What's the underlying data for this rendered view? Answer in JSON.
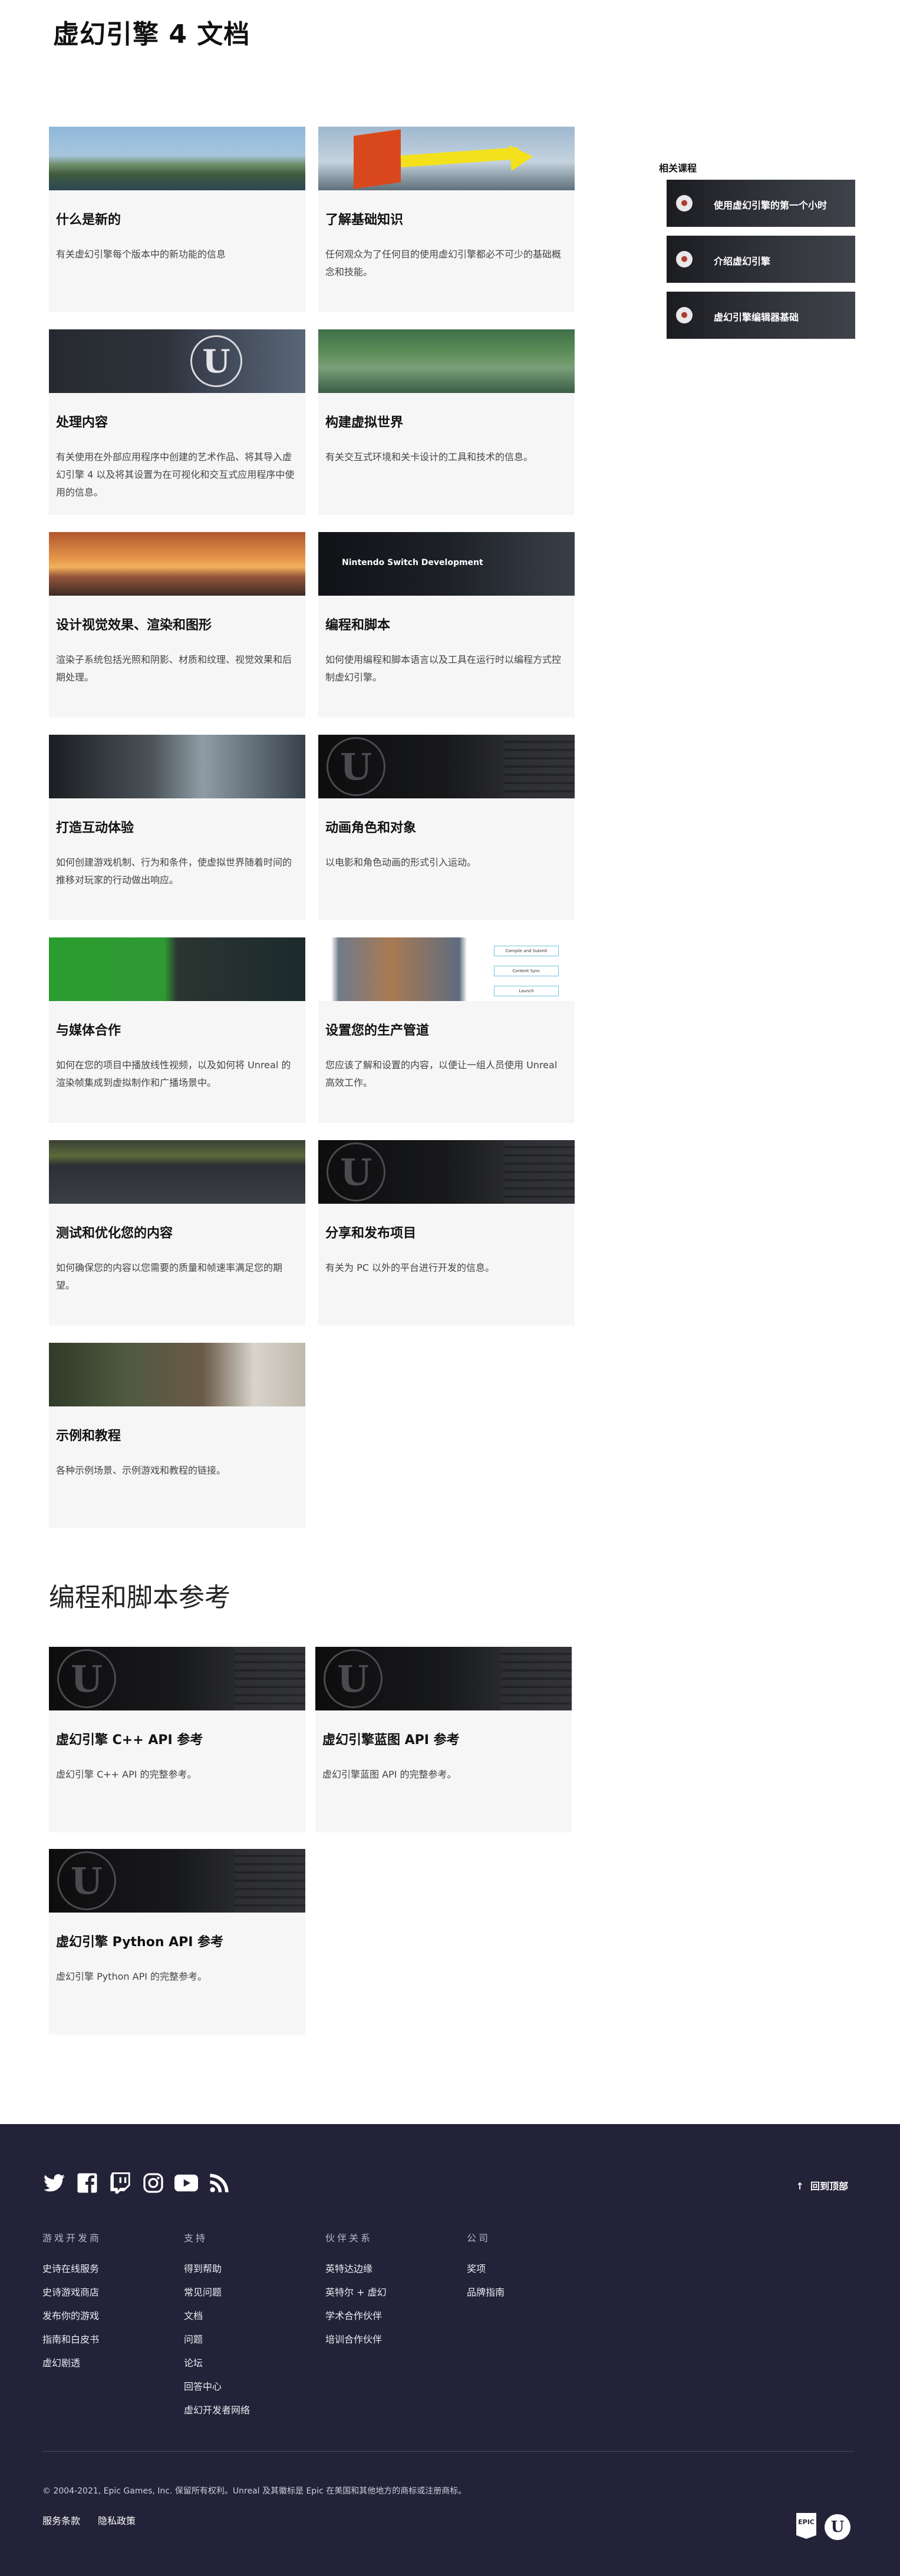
{
  "page": {
    "title": "虚幻引擎 4 文档"
  },
  "topics": [
    {
      "title": "什么是新的",
      "desc": "有关虚幻引擎每个版本中的新功能的信息",
      "thumb": "island-scene"
    },
    {
      "title": "了解基础知识",
      "desc": "任何观众为了任何目的使用虚幻引擎都必不可少的基础概念和技能。",
      "thumb": "arrow-scene"
    },
    {
      "title": "处理内容",
      "desc": "有关使用在外部应用程序中创建的艺术作品、将其导入虚幻引擎 4 以及将其设置为在可视化和交互式应用程序中使用的信息。",
      "thumb": "content-editor"
    },
    {
      "title": "构建虚拟世界",
      "desc": "有关交互式环境和关卡设计的工具和技术的信息。",
      "thumb": "village-scene"
    },
    {
      "title": "设计视觉效果、渲染和图形",
      "desc": "渲染子系统包括光照和阴影、材质和纹理、视觉效果和后期处理。",
      "thumb": "sunset-scene"
    },
    {
      "title": "编程和脚本",
      "desc": "如何使用编程和脚本语言以及工具在运行时以编程方式控制虚幻引擎。",
      "thumb": "switch-dev",
      "overlay": "Nintendo Switch Development"
    },
    {
      "title": "打造互动体验",
      "desc": "如何创建游戏机制、行为和条件，使虚拟世界随着时间的推移对玩家的行动做出响应。",
      "thumb": "speed-scene"
    },
    {
      "title": "动画角色和对象",
      "desc": "以电影和角色动画的形式引入运动。",
      "thumb": "ue-logo"
    },
    {
      "title": "与媒体合作",
      "desc": "如何在您的项目中播放线性视频，以及如何将 Unreal 的渲染帧集成到虚拟制作和广播场景中。",
      "thumb": "greenscreen"
    },
    {
      "title": "设置您的生产管道",
      "desc": "您应该了解和设置的内容，以便让一组人员使用 Unreal 高效工作。",
      "thumb": "pipeline",
      "boxes": [
        "Compile and Submit",
        "Content Sync",
        "Launch"
      ]
    },
    {
      "title": "测试和优化您的内容",
      "desc": "如何确保您的内容以您需要的质量和帧速率满足您的期望。",
      "thumb": "profiler"
    },
    {
      "title": "分享和发布项目",
      "desc": "有关为 PC 以外的平台进行开发的信息。",
      "thumb": "ue-logo"
    },
    {
      "title": "示例和教程",
      "desc": "各种示例场景、示例游戏和教程的链接。",
      "thumb": "samples"
    }
  ],
  "reference": {
    "heading": "编程和脚本参考",
    "items": [
      {
        "title": "虚幻引擎 C++ API 参考",
        "desc": "虚幻引擎 C++ API 的完整参考。"
      },
      {
        "title": "虚幻引擎蓝图 API 参考",
        "desc": "虚幻引擎蓝图 API 的完整参考。"
      },
      {
        "title": "虚幻引擎 Python API 参考",
        "desc": "虚幻引擎 Python API 的完整参考。"
      }
    ]
  },
  "related": {
    "heading": "相关课程",
    "items": [
      {
        "label": "使用虚幻引擎的第一个小时"
      },
      {
        "label": "介绍虚幻引擎"
      },
      {
        "label": "虚幻引擎编辑器基础"
      }
    ]
  },
  "footer": {
    "social": [
      "twitter-icon",
      "facebook-icon",
      "twitch-icon",
      "instagram-icon",
      "youtube-icon",
      "rss-icon"
    ],
    "back_to_top": "回到顶部",
    "columns": [
      {
        "heading": "游戏开发商",
        "links": [
          "史诗在线服务",
          "史诗游戏商店",
          "发布你的游戏",
          "指南和白皮书",
          "虚幻剧透"
        ]
      },
      {
        "heading": "支持",
        "links": [
          "得到帮助",
          "常见问题",
          "文档",
          "问题",
          "论坛",
          "回答中心",
          "虚幻开发者网络"
        ]
      },
      {
        "heading": "伙伴关系",
        "links": [
          "英特达边缘",
          "英特尔 + 虚幻",
          "学术合作伙伴",
          "培训合作伙伴"
        ]
      },
      {
        "heading": "公司",
        "links": [
          "奖项",
          "品牌指南"
        ]
      }
    ],
    "copyright": "© 2004-2021, Epic Games, Inc. 保留所有权利。Unreal 及其徽标是 Epic 在美国和其他地方的商标或注册商标。",
    "legal": [
      "服务条款",
      "隐私政策"
    ]
  }
}
